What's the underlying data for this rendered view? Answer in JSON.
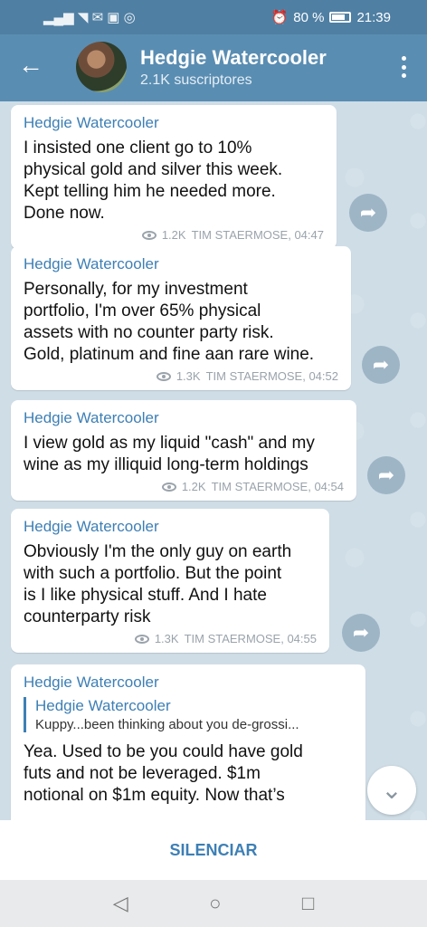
{
  "status": {
    "left_icons": "▂▄▆ ◥ ✉ ▣ ◎",
    "alarm": "⏰",
    "battery_text": "80 %",
    "time": "21:39"
  },
  "appbar": {
    "title": "Hedgie Watercooler",
    "subtitle": "2.1K suscriptores",
    "back_glyph": "←"
  },
  "messages": [
    {
      "sender": "Hedgie Watercooler",
      "text": "I insisted one client go to 10%\nphysical gold and silver this week.\nKept telling him he needed more.\nDone now.",
      "views": "1.2K",
      "author_time": "TIM STAERMOSE, 04:47"
    },
    {
      "sender": "Hedgie Watercooler",
      "text": "Personally, for my investment\nportfolio, I'm over 65% physical\nassets with no counter party risk.\nGold, platinum and fine aan rare wine.",
      "views": "1.3K",
      "author_time": "TIM STAERMOSE, 04:52"
    },
    {
      "sender": "Hedgie Watercooler",
      "text": "I view gold as my liquid \"cash\" and my\nwine as my illiquid long-term holdings",
      "views": "1.2K",
      "author_time": "TIM STAERMOSE, 04:54"
    },
    {
      "sender": "Hedgie Watercooler",
      "text": "Obviously I'm the only guy on earth\nwith such a portfolio. But the point\nis I like physical stuff. And I hate\ncounterparty risk",
      "views": "1.3K",
      "author_time": "TIM STAERMOSE, 04:55"
    },
    {
      "sender": "Hedgie Watercooler",
      "reply_sender": "Hedgie Watercooler",
      "reply_text": "Kuppy...been thinking about you de-grossi...",
      "text": "Yea. Used to be you could have gold\nfuts and not be leveraged. $1m\nnotional on $1m equity. Now that’s"
    }
  ],
  "share_glyph": "➦",
  "scroll_down_glyph": "⌄",
  "bottom": {
    "mute_label": "SILENCIAR"
  },
  "navbar": {
    "back": "◁",
    "home": "○",
    "recents": "□"
  },
  "colors": {
    "appbar": "#5a8db2",
    "accent": "#3d7fb5",
    "chat_bg": "#cfdde6"
  }
}
